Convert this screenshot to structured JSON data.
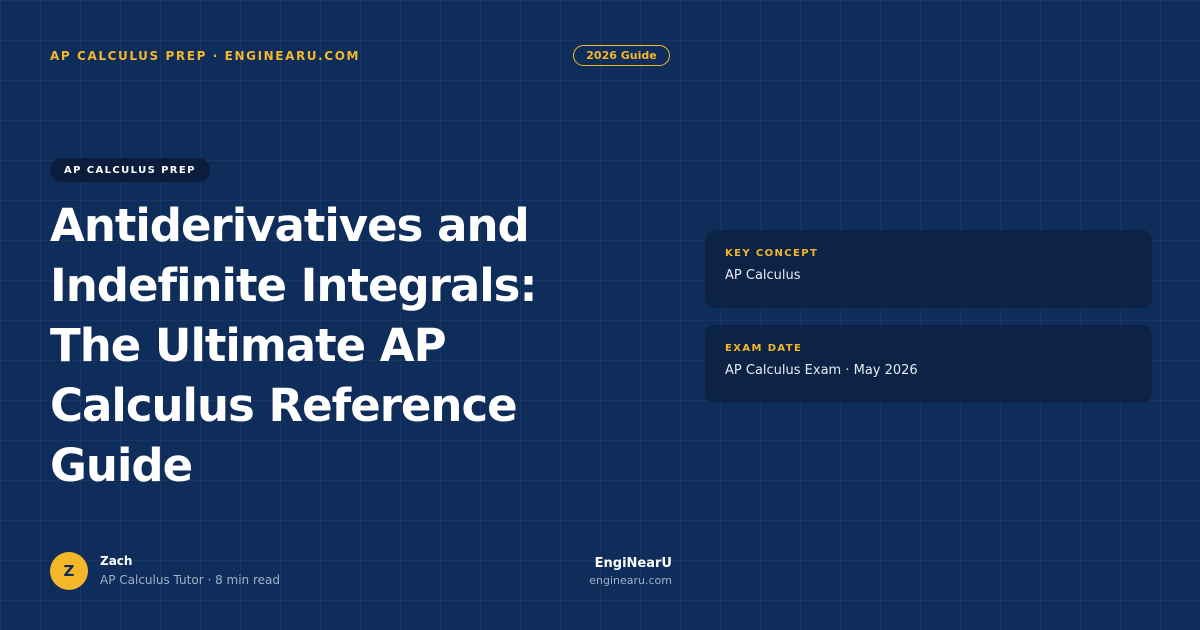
{
  "header": {
    "kicker": "AP CALCULUS PREP · ENGINEARU.COM",
    "year_badge": "2026 Guide"
  },
  "hero": {
    "category": "AP CALCULUS PREP",
    "title": "Antiderivatives and Indefinite Integrals: The Ultimate AP Calculus Reference Guide"
  },
  "cards": [
    {
      "label": "KEY CONCEPT",
      "value": "AP Calculus"
    },
    {
      "label": "EXAM DATE",
      "value": "AP Calculus Exam · May 2026"
    }
  ],
  "author": {
    "initial": "Z",
    "name": "Zach",
    "meta": "AP Calculus Tutor · 8 min read"
  },
  "brand": {
    "name": "EngiNearU",
    "url": "enginearu.com"
  },
  "colors": {
    "background": "#0f2d5a",
    "accent": "#f5b72a",
    "card": "#0c2346",
    "chip": "#0a1d3d"
  }
}
